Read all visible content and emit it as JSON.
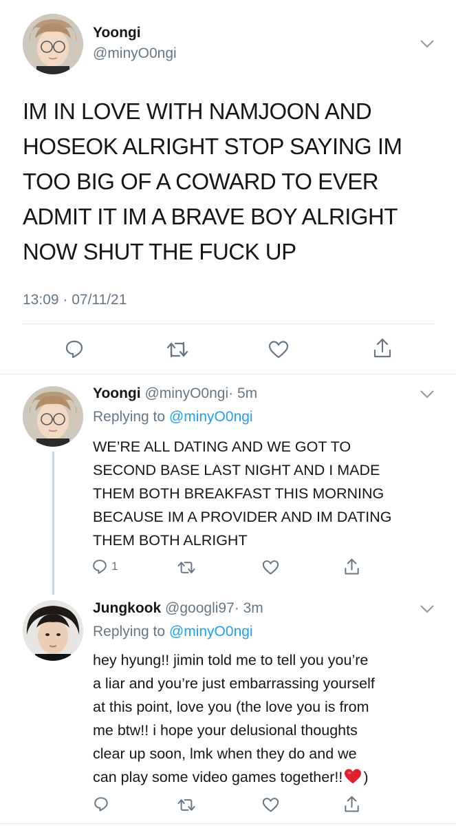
{
  "main_tweet": {
    "name": "Yoongi",
    "handle": "@minyO0ngi",
    "text_lines": [
      "IM IN LOVE WITH NAMJOON AND",
      "HOSEOK ALRIGHT STOP SAYING IM",
      "TOO BIG OF A COWARD TO EVER",
      "ADMIT IT IM A BRAVE BOY ALRIGHT",
      "NOW SHUT THE FUCK UP"
    ],
    "timestamp": "13:09 · 07/11/21"
  },
  "reply1": {
    "name": "Yoongi",
    "handle": "@minyO0ngi",
    "time": "· 5m",
    "replying_prefix": "Replying to ",
    "replying_handle": "@minyO0ngi",
    "text_lines": [
      "WE’RE ALL DATING AND WE GOT TO",
      "SECOND BASE LAST NIGHT AND I MADE",
      "THEM BOTH BREAKFAST THIS MORNING",
      "BECAUSE IM A PROVIDER AND IM DATING",
      "THEM BOTH ALRIGHT"
    ],
    "reply_count": "1"
  },
  "reply2": {
    "name": "Jungkook",
    "handle": "@googli97",
    "time": "· 3m",
    "replying_prefix": "Replying to ",
    "replying_handle": "@minyO0ngi",
    "text_lines": [
      "hey hyung!! jimin told me to tell you you’re",
      "a liar and you’re just embarrassing yourself",
      "at this point, love you (the love you is from",
      "me btw!! i hope your delusional thoughts",
      "clear up soon, lmk when they do and we",
      "can play some video games together!!"
    ],
    "last_line_suffix": ")"
  },
  "colors": {
    "accent": "#1da1f2",
    "muted": "#657786",
    "text": "#14171a",
    "divider": "#e1e8ed",
    "heart_emoji": "#e0202f"
  },
  "icons": {
    "chevron": "chevron-down-icon",
    "reply": "reply-icon",
    "retweet": "retweet-icon",
    "like": "like-icon",
    "share": "share-icon",
    "emoji": "red-heart-emoji"
  }
}
